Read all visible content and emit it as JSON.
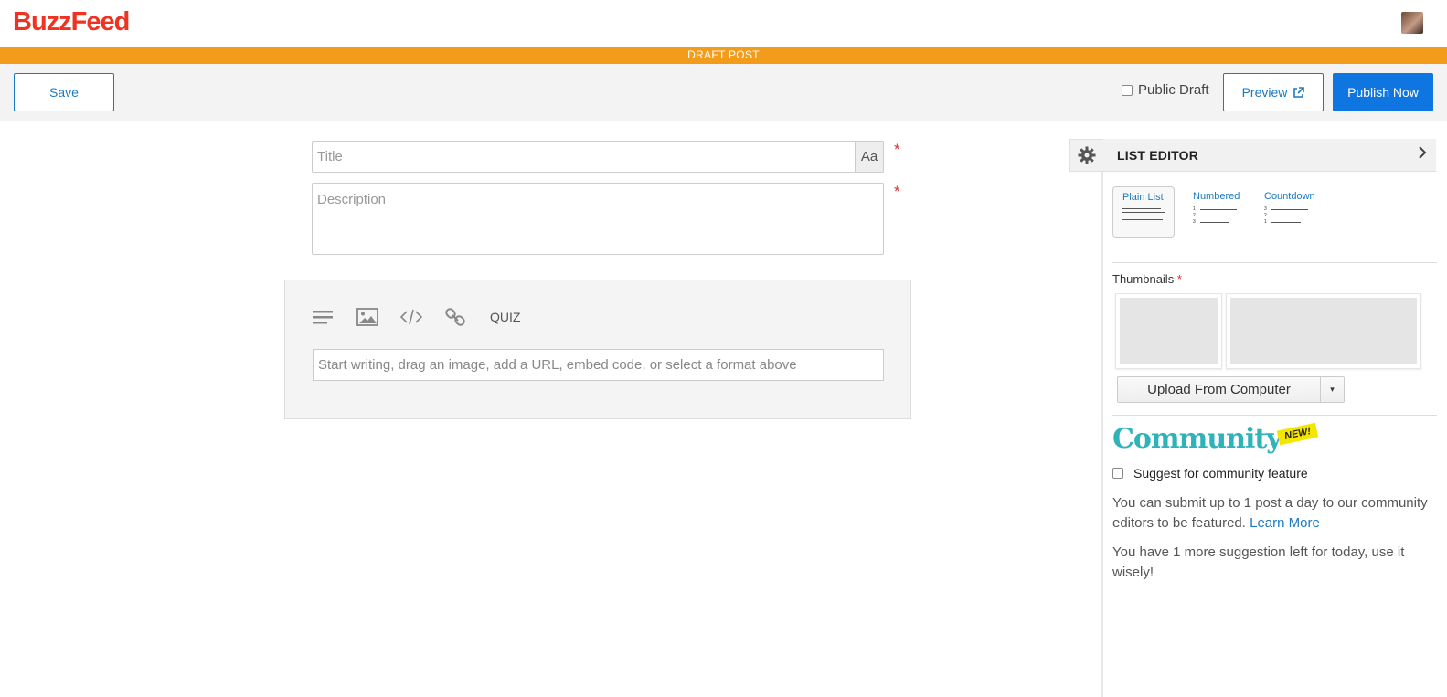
{
  "header": {
    "logo_text": "BuzzFeed",
    "logo_color": "#e32",
    "avatar_icon": "user-avatar"
  },
  "draft_banner": {
    "text": "DRAFT POST",
    "color": "#f39c1b"
  },
  "toolbar": {
    "save_label": "Save",
    "public_draft_label": "Public Draft",
    "public_draft_checked": false,
    "preview_label": "Preview",
    "preview_icon": "external-link-icon",
    "publish_label": "Publish Now",
    "publish_color": "#0f75e0",
    "accent_color": "#1a7ac0"
  },
  "editor": {
    "title_placeholder": "Title",
    "font_toggle_label": "Aa",
    "required_mark": "*",
    "description_placeholder": "Description",
    "tools": [
      "text-icon",
      "image-icon",
      "embed-code-icon",
      "link-icon"
    ],
    "quiz_label": "QUIZ",
    "compose_placeholder": "Start writing, drag an image, add a URL, embed code, or select a format above"
  },
  "list_editor": {
    "title": "LIST EDITOR",
    "settings_icon": "gear-icon",
    "collapse_icon": "chevron-right-icon",
    "formats": [
      {
        "label": "Plain List",
        "selected": true
      },
      {
        "label": "Numbered",
        "selected": false,
        "numbers": [
          "1",
          "2",
          "3"
        ]
      },
      {
        "label": "Countdown",
        "selected": false,
        "numbers": [
          "3",
          "2",
          "1"
        ]
      }
    ],
    "thumbnails_label": "Thumbnails",
    "required_mark": "*",
    "upload_label": "Upload From Computer",
    "upload_caret": "▾"
  },
  "community": {
    "logo_text": "Community",
    "badge": "NEW!",
    "suggest_label": "Suggest for community feature",
    "suggest_checked": false,
    "info_text": "You can submit up to 1 post a day to our community editors to be featured.",
    "learn_more": "Learn More",
    "remaining_text": "You have 1 more suggestion left for today, use it wisely!"
  }
}
